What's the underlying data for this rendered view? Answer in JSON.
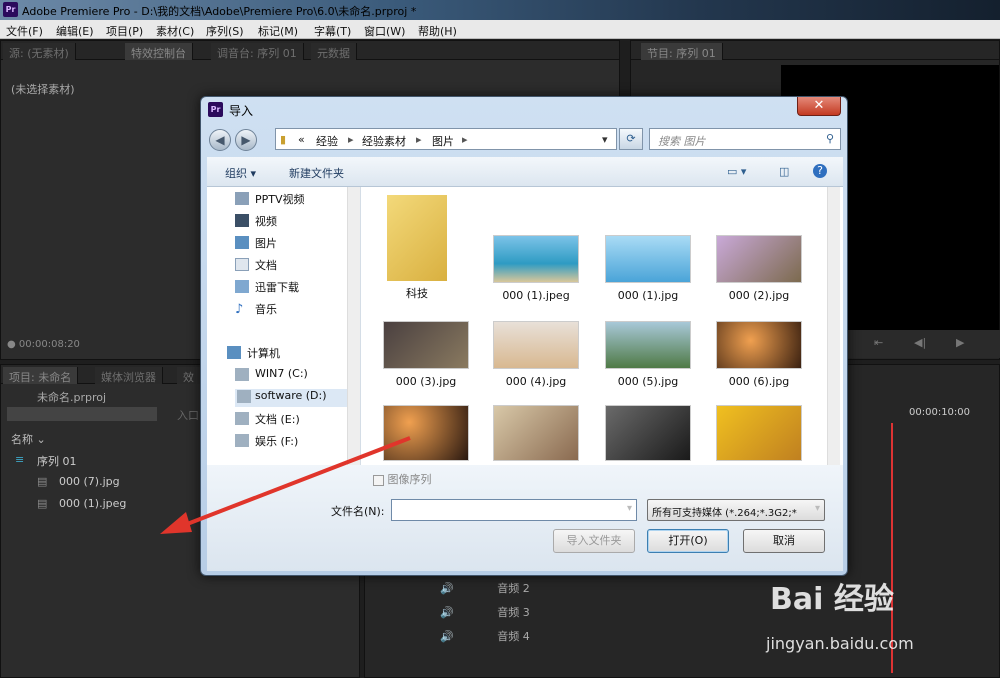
{
  "app": {
    "logo": "Pr",
    "title": "Adobe Premiere Pro - D:\\我的文档\\Adobe\\Premiere Pro\\6.0\\未命名.prproj *"
  },
  "menu": [
    "文件(F)",
    "编辑(E)",
    "项目(P)",
    "素材(C)",
    "序列(S)",
    "标记(M)",
    "字幕(T)",
    "窗口(W)",
    "帮助(H)"
  ],
  "source_panel": {
    "tabs": [
      "源: (无素材)",
      "特效控制台",
      "调音台: 序列 01",
      "元数据"
    ],
    "no_clip": "(未选择素材)",
    "timecode": "00:00:08:20"
  },
  "program_panel": {
    "tab": "节目: 序列 01"
  },
  "project_panel": {
    "tabs": [
      "项目: 未命名",
      "媒体浏览器",
      "效"
    ],
    "project_file": "未命名.prproj",
    "in_point_label": "入口",
    "column_name": "名称",
    "items": [
      "序列 01",
      "000 (7).jpg",
      "000 (1).jpeg"
    ]
  },
  "timeline": {
    "timecode": "00:00:10:00",
    "audio_tracks": [
      "音频 2",
      "音频 3",
      "音频 4"
    ]
  },
  "dialog": {
    "logo": "Pr",
    "title": "导入",
    "close": "✕",
    "breadcrumb": [
      "«",
      "经验",
      "经验素材",
      "图片"
    ],
    "search_placeholder": "搜索 图片",
    "toolbar": {
      "organize": "组织 ▾",
      "new_folder": "新建文件夹"
    },
    "nav_items": [
      {
        "label": "PPTV视频",
        "icon": "video-icon"
      },
      {
        "label": "视频",
        "icon": "film-icon"
      },
      {
        "label": "图片",
        "icon": "picture-icon"
      },
      {
        "label": "文档",
        "icon": "document-icon"
      },
      {
        "label": "迅雷下载",
        "icon": "download-icon"
      },
      {
        "label": "音乐",
        "icon": "music-icon"
      },
      {
        "label": "计算机",
        "icon": "computer-icon"
      },
      {
        "label": "WIN7 (C:)",
        "icon": "drive-icon"
      },
      {
        "label": "software (D:)",
        "icon": "drive-icon"
      },
      {
        "label": "文档 (E:)",
        "icon": "drive-icon"
      },
      {
        "label": "娱乐 (F:)",
        "icon": "drive-icon"
      }
    ],
    "files": [
      {
        "name": "科技",
        "color": "#e8c560"
      },
      {
        "name": "000 (1).jpeg",
        "color": "#3fa7c6"
      },
      {
        "name": "000 (1).jpg",
        "color": "#58b5e0"
      },
      {
        "name": "000 (2).jpg",
        "color": "#8a7a5c"
      },
      {
        "name": "000 (3).jpg",
        "color": "#6b5a4a"
      },
      {
        "name": "000 (4).jpg",
        "color": "#d9b88a"
      },
      {
        "name": "000 (5).jpg",
        "color": "#5f8a52"
      },
      {
        "name": "000 (6).jpg",
        "color": "#c06a2a"
      },
      {
        "name": "",
        "color": "#b05a28"
      },
      {
        "name": "",
        "color": "#c9a070"
      },
      {
        "name": "",
        "color": "#3a3a3a"
      },
      {
        "name": "",
        "color": "#e0b020"
      }
    ],
    "image_sequence": "图像序列",
    "filename_label": "文件名(N):",
    "filename_value": "",
    "filter": "所有可支持媒体 (*.264;*.3G2;*",
    "import_folder": "导入文件夹",
    "open": "打开(O)",
    "cancel": "取消"
  },
  "watermark": {
    "brand": "Bai 经验",
    "url": "jingyan.baidu.com"
  }
}
